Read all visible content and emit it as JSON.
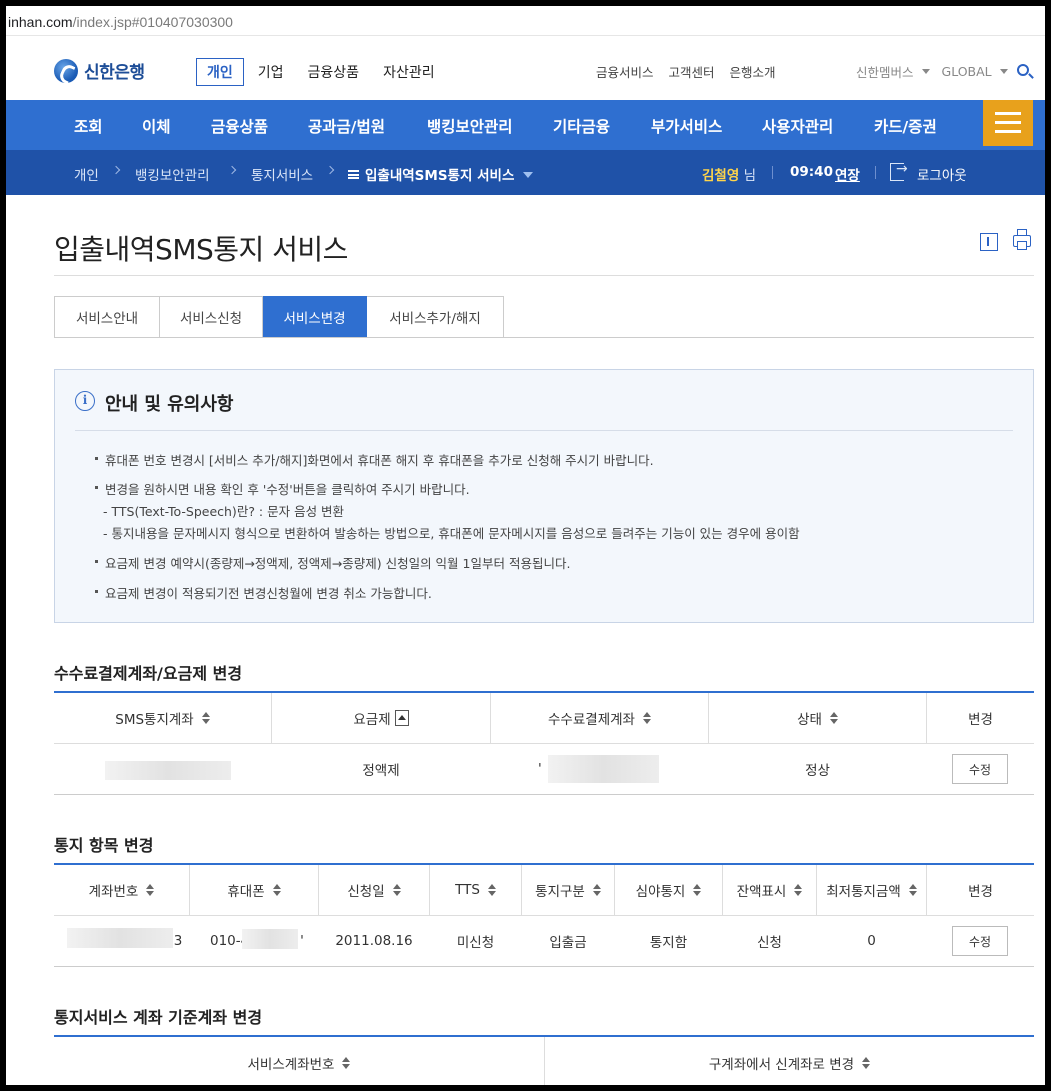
{
  "browser": {
    "url_host": "inhan.com",
    "url_path": "/index.jsp#010407030300"
  },
  "header": {
    "logo_text": "신한은행",
    "segment_active": "개인",
    "segments": [
      "기업",
      "금융상품",
      "자산관리"
    ],
    "util_links": [
      "금융서비스",
      "고객센터",
      "은행소개"
    ],
    "member": "신한멤버스",
    "global": "GLOBAL"
  },
  "mainnav": {
    "items": [
      "조회",
      "이체",
      "금융상품",
      "공과금/법원",
      "뱅킹보안관리",
      "기타금융",
      "부가서비스",
      "사용자관리",
      "카드/증권"
    ],
    "accent": "#2f6fd0",
    "menu_button_color": "#e8a11c"
  },
  "subnav": {
    "crumbs": [
      "개인",
      "뱅킹보안관리",
      "통지서비스"
    ],
    "current": "입출내역SMS통지 서비스",
    "user_name": "김철영",
    "user_suffix": "님",
    "time": "09:40",
    "extend": "연장",
    "logout": "로그아웃"
  },
  "page": {
    "title": "입출내역SMS통지 서비스"
  },
  "tabs": [
    "서비스안내",
    "서비스신청",
    "서비스변경",
    "서비스추가/해지"
  ],
  "active_tab": 2,
  "notice": {
    "title": "안내 및 유의사항",
    "lines": [
      "휴대폰 번호 변경시 [서비스 추가/해지]화면에서 휴대폰 해지 후 휴대폰을 추가로 신청해 주시기 바랍니다.",
      "변경을 원하시면 내용 확인 후 '수정'버튼을 클릭하여 주시기 바랍니다.",
      "- TTS(Text-To-Speech)란? : 문자 음성 변환",
      "- 통지내용을 문자메시지 형식으로 변환하여 발송하는 방법으로, 휴대폰에 문자메시지를 음성으로 들려주는 기능이 있는 경우에 용이함",
      "요금제 변경 예약시(종량제→정액제, 정액제→종량제) 신청일의 익월 1일부터 적용됩니다.",
      "요금제 변경이 적용되기전 변경신청월에 변경 취소 가능합니다."
    ]
  },
  "section1": {
    "title": "수수료결제계좌/요금제 변경",
    "headers": [
      "SMS통지계좌",
      "요금제",
      "수수료결제계좌",
      "상태",
      "변경"
    ],
    "row": {
      "plan": "정액제",
      "status": "정상",
      "button": "수정",
      "fee_prefix": "'"
    }
  },
  "section2": {
    "title": "통지 항목 변경",
    "headers": [
      "계좌번호",
      "휴대폰",
      "신청일",
      "TTS",
      "통지구분",
      "심야통지",
      "잔액표시",
      "최저통지금액",
      "변경"
    ],
    "row": {
      "account_suffix": "3",
      "phone": "010-4",
      "phone_suffix": "'",
      "date": "2011.08.16",
      "tts": "미신청",
      "type": "입출금",
      "night": "통지함",
      "balance": "신청",
      "min_amount": "0",
      "button": "수정"
    }
  },
  "section3": {
    "title": "통지서비스 계좌 기준계좌 변경",
    "headers": [
      "서비스계좌번호",
      "구계좌에서 신계좌로 변경"
    ]
  }
}
